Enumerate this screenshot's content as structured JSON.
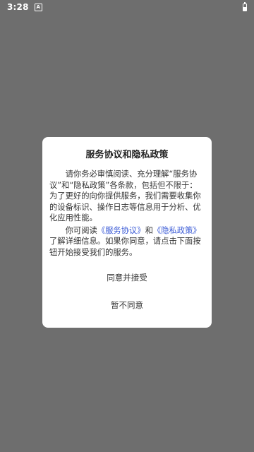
{
  "status_bar": {
    "time": "3:28",
    "notification_glyph": "A",
    "icons": [
      "notification-icon",
      "battery-icon"
    ]
  },
  "dialog": {
    "title": "服务协议和隐私政策",
    "paragraph1": "请你务必审慎阅读、充分理解“服务协议”和“隐私政策”各条款，包括但不限于：为了更好的向你提供服务，我们需要收集你的设备标识、操作日志等信息用于分析、优化应用性能。",
    "paragraph2_prefix": "你可阅读",
    "link_service": "《服务协议》",
    "paragraph2_and": "和",
    "link_privacy": "《隐私政策》",
    "paragraph2_suffix": "了解详细信息。如果你同意，请点击下面按钮开始接受我们的服务。",
    "agree_button": "同意并接受",
    "disagree_button": "暂不同意"
  },
  "colors": {
    "overlay": "#6e6e6e",
    "dialog_bg": "#ffffff",
    "link": "#3b5bd6",
    "text": "#333333"
  }
}
